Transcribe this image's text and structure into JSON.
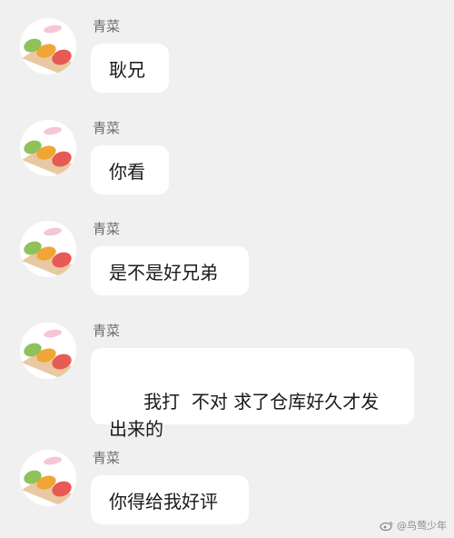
{
  "conversation": {
    "messages": [
      {
        "sender": "青菜",
        "text": "耿兄"
      },
      {
        "sender": "青菜",
        "text": "你看"
      },
      {
        "sender": "青菜",
        "text": "是不是好兄弟"
      },
      {
        "sender": "青菜",
        "text": "我打  不对 求了仓库好久才发出来的"
      },
      {
        "sender": "青菜",
        "text": "你得给我好评"
      }
    ]
  },
  "watermark": {
    "text": "@鸟莺少年",
    "icon": "weibo-icon"
  },
  "colors": {
    "background": "#f0f0f0",
    "bubble": "#ffffff",
    "sender_name": "#6b6b6b",
    "message_text": "#1a1a1a",
    "avatar_green": "#8fc25a",
    "avatar_orange": "#f1a534",
    "avatar_red": "#e85a54",
    "avatar_board": "#e9c9a3"
  }
}
